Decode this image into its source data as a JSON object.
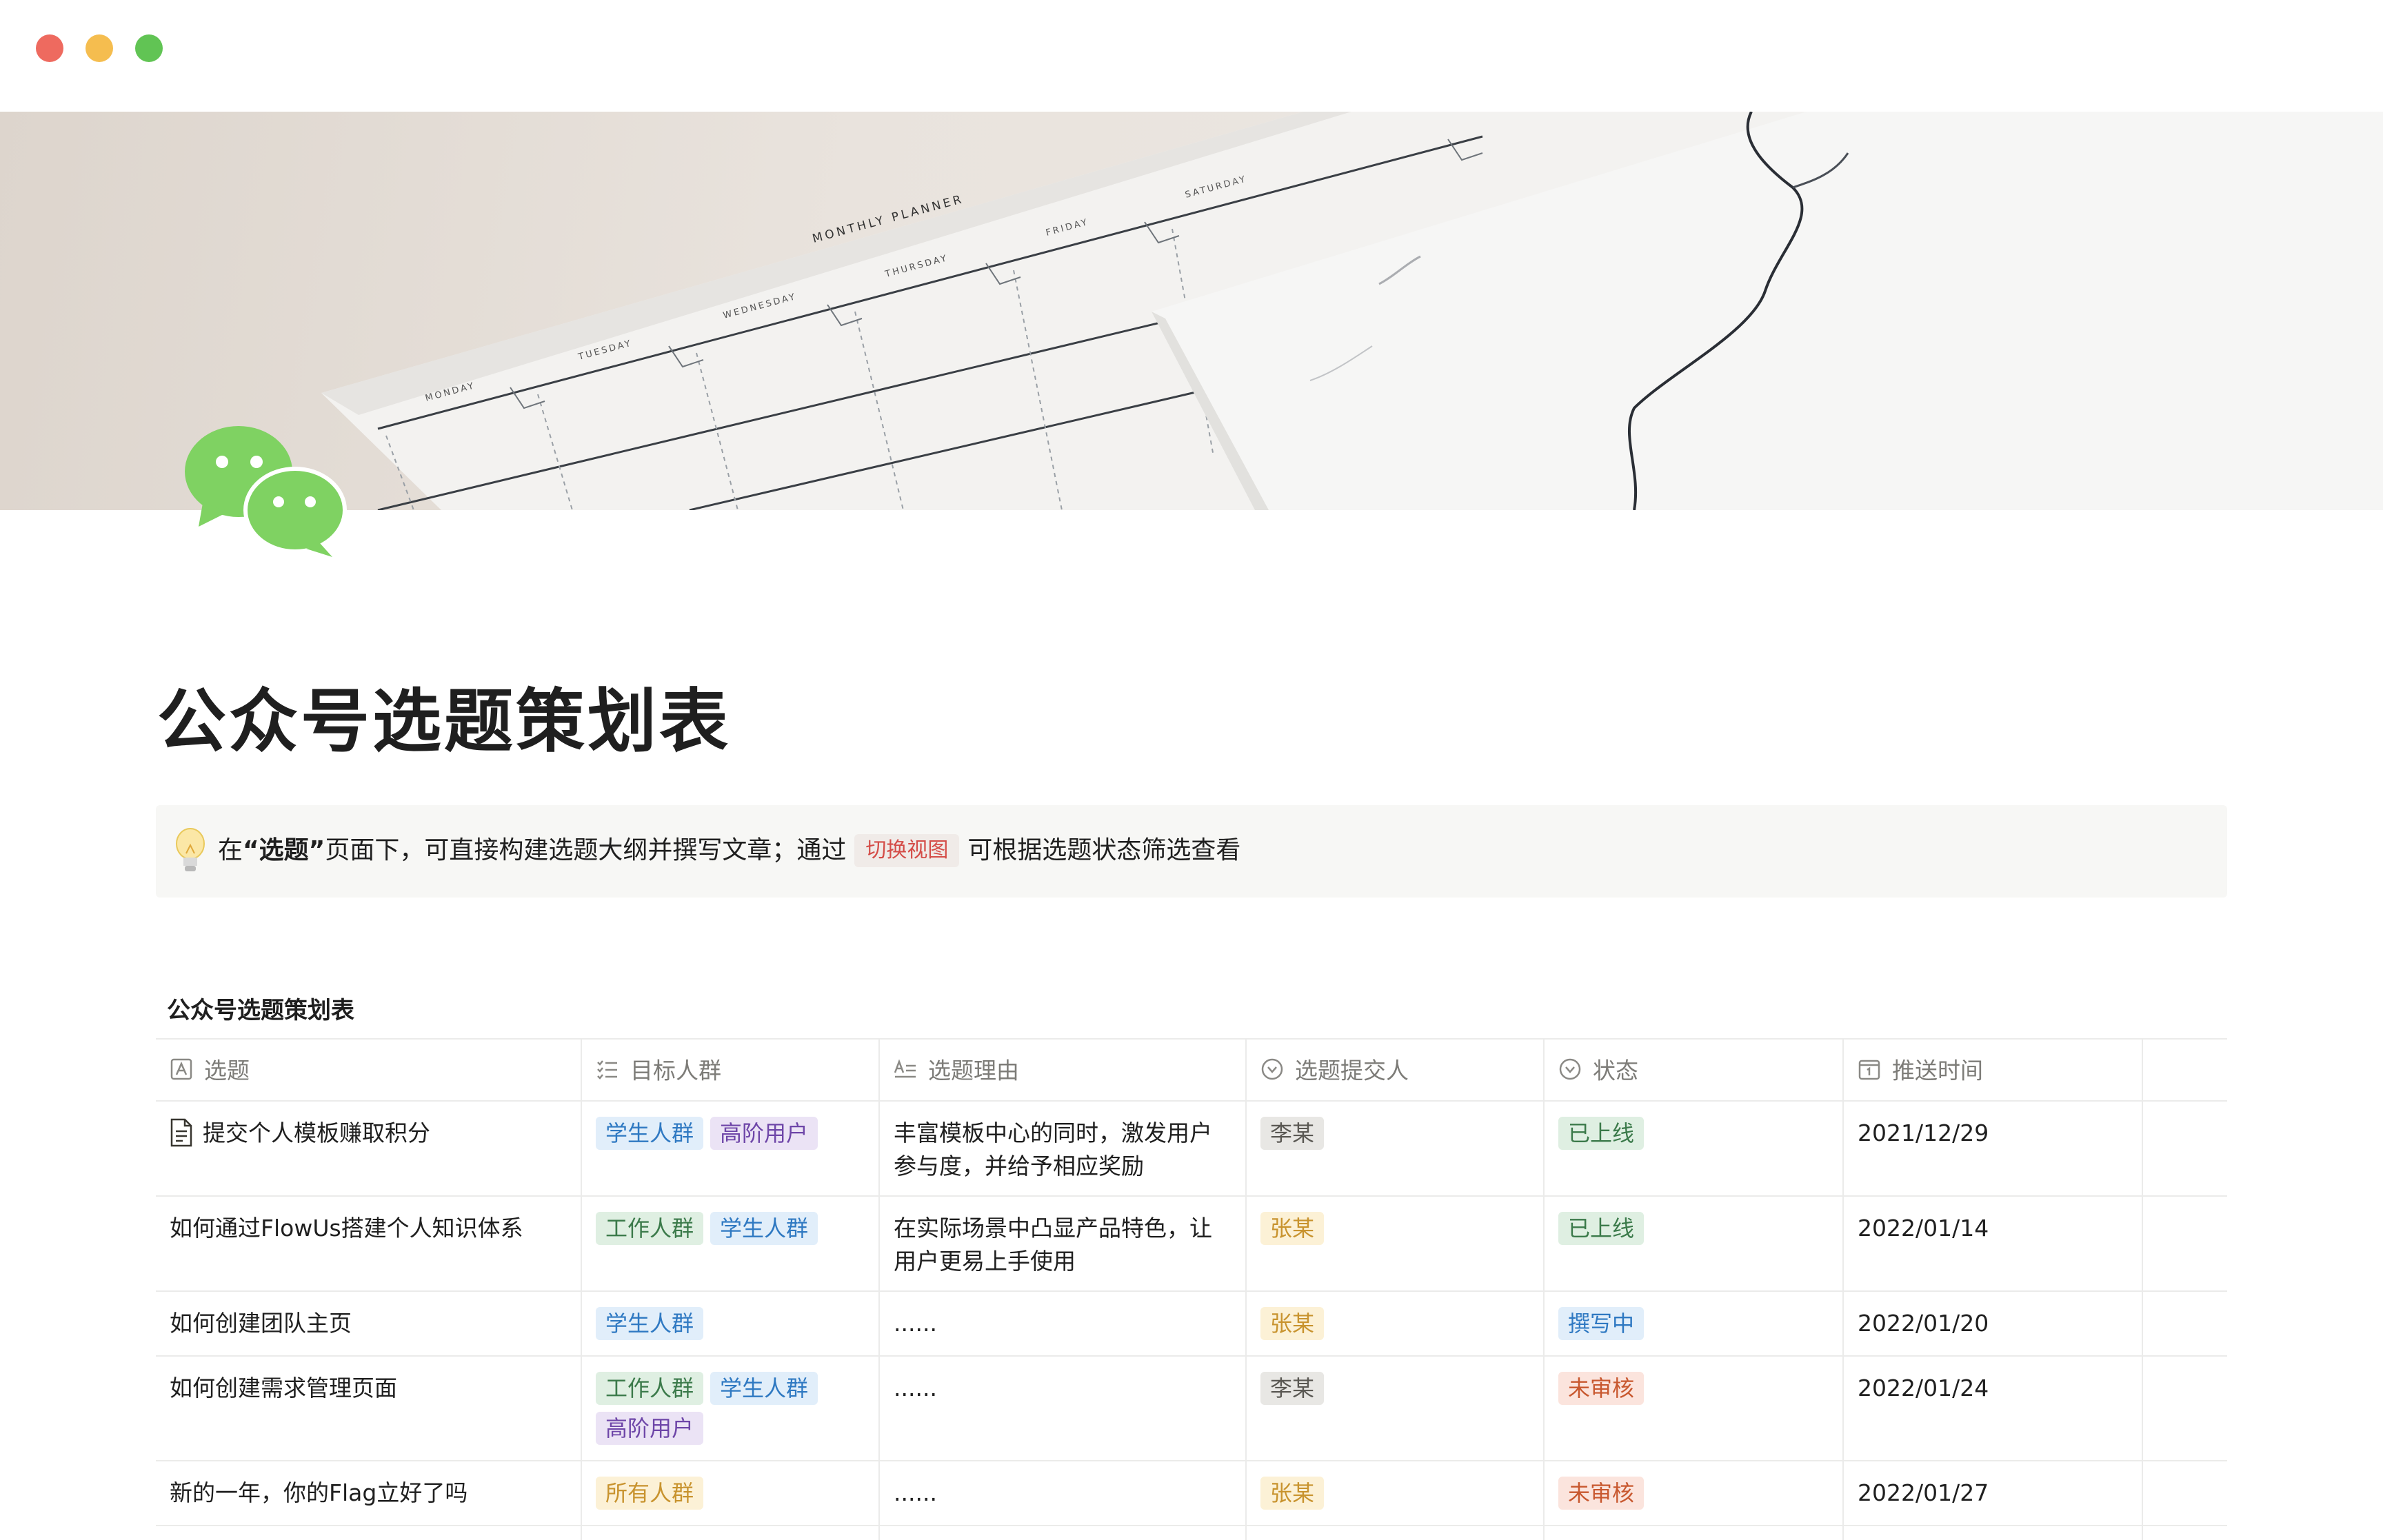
{
  "page": {
    "title": "公众号选题策划表"
  },
  "cover": {
    "planner_title": "MONTHLY PLANNER",
    "days": [
      "MONDAY",
      "TUESDAY",
      "WEDNESDAY",
      "THURSDAY",
      "FRIDAY",
      "SATURDAY"
    ]
  },
  "callout": {
    "prefix": "在",
    "highlight": "“选题”",
    "middle": "页面下，可直接构建选题大纲并撰写文章；通过",
    "code": "切换视图",
    "suffix": "可根据选题状态筛选查看"
  },
  "database": {
    "title": "公众号选题策划表",
    "columns": [
      {
        "label": "选题",
        "icon": "text-icon"
      },
      {
        "label": "目标人群",
        "icon": "multi-select-icon"
      },
      {
        "label": "选题理由",
        "icon": "long-text-icon"
      },
      {
        "label": "选题提交人",
        "icon": "select-icon"
      },
      {
        "label": "状态",
        "icon": "select-icon"
      },
      {
        "label": "推送时间",
        "icon": "calendar-icon"
      }
    ],
    "rows": [
      {
        "topic": "提交个人模板赚取积分",
        "has_doc_icon": true,
        "audience": [
          {
            "label": "学生人群",
            "color": "blue"
          },
          {
            "label": "高阶用户",
            "color": "purple"
          }
        ],
        "reason": "丰富模板中心的同时，激发用户参与度，并给予相应奖励",
        "submitter": {
          "label": "李某",
          "color": "gray"
        },
        "status": {
          "label": "已上线",
          "color": "green"
        },
        "date": "2021/12/29"
      },
      {
        "topic": "如何通过FlowUs搭建个人知识体系",
        "has_doc_icon": false,
        "audience": [
          {
            "label": "工作人群",
            "color": "green"
          },
          {
            "label": "学生人群",
            "color": "blue"
          }
        ],
        "reason": "在实际场景中凸显产品特色，让用户更易上手使用",
        "submitter": {
          "label": "张某",
          "color": "yellow"
        },
        "status": {
          "label": "已上线",
          "color": "green"
        },
        "date": "2022/01/14"
      },
      {
        "topic": "如何创建团队主页",
        "has_doc_icon": false,
        "audience": [
          {
            "label": "学生人群",
            "color": "blue"
          }
        ],
        "reason": "......",
        "submitter": {
          "label": "张某",
          "color": "yellow"
        },
        "status": {
          "label": "撰写中",
          "color": "blue"
        },
        "date": "2022/01/20"
      },
      {
        "topic": "如何创建需求管理页面",
        "has_doc_icon": false,
        "audience": [
          {
            "label": "工作人群",
            "color": "green"
          },
          {
            "label": "学生人群",
            "color": "blue"
          },
          {
            "label": "高阶用户",
            "color": "purple"
          }
        ],
        "reason": "......",
        "submitter": {
          "label": "李某",
          "color": "gray"
        },
        "status": {
          "label": "未审核",
          "color": "red"
        },
        "date": "2022/01/24"
      },
      {
        "topic": "新的一年，你的Flag立好了吗",
        "has_doc_icon": false,
        "audience": [
          {
            "label": "所有人群",
            "color": "yellow"
          }
        ],
        "reason": "......",
        "submitter": {
          "label": "张某",
          "color": "yellow"
        },
        "status": {
          "label": "未审核",
          "color": "red"
        },
        "date": "2022/01/27"
      }
    ]
  },
  "colors": {
    "traffic_red": "#ee6a5f",
    "traffic_yellow": "#f5bd4f",
    "traffic_green": "#61c454",
    "wechat_green": "#7fd262",
    "inline_code_text": "#d44c47"
  }
}
